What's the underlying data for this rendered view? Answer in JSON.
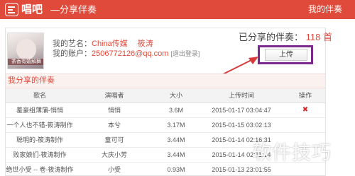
{
  "header": {
    "brand": "唱吧",
    "page_title": "—分享伴奏",
    "account_link": "我的伴奏"
  },
  "profile": {
    "avatar_caption": "茶香有嬉解舞",
    "artist_label": "我的艺名：",
    "artist_name": "China传媒",
    "artist_extra": "筱涛",
    "account_label": "我的账户：",
    "account_value": "2506772126@qq.com",
    "logout": "[退出登录]"
  },
  "stats": {
    "shared_label": "已分享的伴奏：",
    "shared_count": "118",
    "shared_unit": "首"
  },
  "upload_button": "上传",
  "section_title": "我分享的伴奏",
  "table": {
    "columns": [
      "歌名",
      "演唱者",
      "大小",
      "上传时间",
      "操作"
    ],
    "rows": [
      {
        "name": "羞豪组薄蒲-悄悄",
        "singer": "悄悄",
        "size": "3.6M",
        "time": "2015-01-17 03:04:47",
        "op": "✖"
      },
      {
        "name": "一个人也不错-筱涛制作",
        "singer": "本兮",
        "size": "3.17M",
        "time": "2015-01-15 03:02:13",
        "op": ""
      },
      {
        "name": "聪明的-筱涛制作",
        "singer": "童可可",
        "size": "3.44M",
        "time": "2015-01-14 02:16:31",
        "op": ""
      },
      {
        "name": "败家娘们-筱涛制作",
        "singer": "大庆小芳",
        "size": "3.44M",
        "time": "2015-01-14 02:11:14",
        "op": ""
      },
      {
        "name": "绝世小受 -- 卷-筱涛制作",
        "singer": "小受",
        "size": "0.93M",
        "time": "2015-01-13 23:01:55",
        "op": ""
      }
    ]
  },
  "watermark": "软件技巧",
  "colors": {
    "brand_red": "#e04a3a",
    "highlight_purple": "#7a2a8c",
    "arrow_red": "#d93a3a"
  }
}
